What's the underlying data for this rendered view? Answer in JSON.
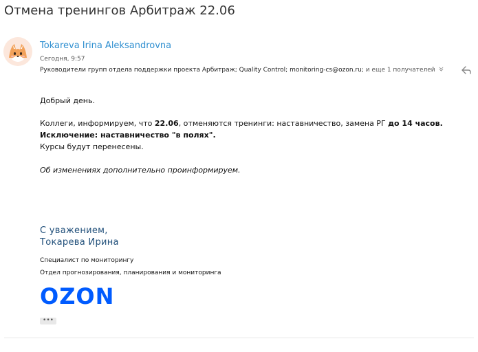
{
  "email": {
    "subject": "Отмена тренингов Арбитраж 22.06",
    "sender": "Tokareva Irina Aleksandrovna",
    "time": "Сегодня, 9:57",
    "recipients": "Руководители групп отдела поддержки проекта Арбитраж; Quality Control; monitoring-cs@ozon.ru;",
    "more_recipients": "и еще 1 получателей"
  },
  "body": {
    "greeting": "Добрый день.",
    "line1_pre": "Коллеги, информируем, что ",
    "line1_date": "22.06",
    "line1_mid": ", отменяются тренинги: наставничество, замена РГ ",
    "line1_bold": "до 14 часов.",
    "line2": "Исключение: наставничество  \"в полях\".",
    "line3": "Курсы будут перенесены.",
    "line4": "Об изменениях дополнительно проинформируем."
  },
  "signature": {
    "regards": "С уважением,",
    "name": "Токарева Ирина",
    "position": "Специалист по мониторингу",
    "department": "Отдел прогнозирования, планирования и мониторинга",
    "logo_text": "OZON",
    "more_dots": "•••"
  },
  "colors": {
    "link": "#2f8fd0",
    "signature": "#1f4e79",
    "brand": "#005bff"
  },
  "icons": {
    "avatar": "fox-avatar-icon",
    "chevron": "chevron-down-icon",
    "reply": "reply-arrow-icon"
  }
}
